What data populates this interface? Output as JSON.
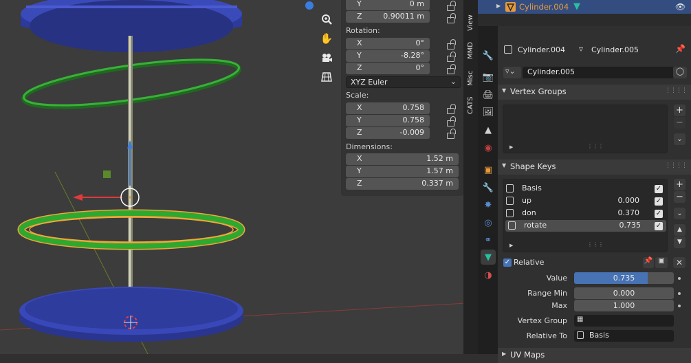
{
  "viewport": {
    "nav_icons": [
      "zoom-icon",
      "hand-icon",
      "camera-icon",
      "grid-icon"
    ]
  },
  "n_panel": {
    "location_partial": [
      {
        "axis": "Y",
        "value": "0 m"
      },
      {
        "axis": "Z",
        "value": "0.90011 m"
      }
    ],
    "rotation_label": "Rotation:",
    "rotation": [
      {
        "axis": "X",
        "value": "0°"
      },
      {
        "axis": "Y",
        "value": "-8.28°"
      },
      {
        "axis": "Z",
        "value": "0°"
      }
    ],
    "rotation_mode": "XYZ Euler",
    "scale_label": "Scale:",
    "scale": [
      {
        "axis": "X",
        "value": "0.758"
      },
      {
        "axis": "Y",
        "value": "0.758"
      },
      {
        "axis": "Z",
        "value": "-0.009"
      }
    ],
    "dimensions_label": "Dimensions:",
    "dimensions": [
      {
        "axis": "X",
        "value": "1.52 m"
      },
      {
        "axis": "Y",
        "value": "1.57 m"
      },
      {
        "axis": "Z",
        "value": "0.337 m"
      }
    ]
  },
  "side_tabs": [
    "View",
    "MMD",
    "Misc",
    "CATS"
  ],
  "outliner": {
    "selected_name": "Cylinder.004",
    "accent": "#e79a3c"
  },
  "properties": {
    "breadcrumb_object": "Cylinder.004",
    "breadcrumb_mesh": "Cylinder.005",
    "mesh_name": "Cylinder.005",
    "vertex_groups_title": "Vertex Groups",
    "shape_keys_title": "Shape Keys",
    "shape_keys": [
      {
        "name": "Basis",
        "value": "",
        "checked": true,
        "active": false
      },
      {
        "name": "up",
        "value": "0.000",
        "checked": true,
        "active": false
      },
      {
        "name": "don",
        "value": "0.370",
        "checked": true,
        "active": false
      },
      {
        "name": "rotate",
        "value": "0.735",
        "checked": true,
        "active": true
      }
    ],
    "relative_label": "Relative",
    "value_label": "Value",
    "value": "0.735",
    "value_fraction": 0.735,
    "range_min_label": "Range Min",
    "range_min": "0.000",
    "max_label": "Max",
    "max": "1.000",
    "vertex_group_label": "Vertex Group",
    "relative_to_label": "Relative To",
    "relative_to": "Basis",
    "next_panel_title": "UV Maps"
  },
  "colors": {
    "selected_row": "#334d80",
    "value_bar": "#4772b3",
    "mesh_icon": "#27c0a0",
    "ring_green": "#2fa82f",
    "ring_outline": "#f2a63a",
    "disc_blue": "#2c3a9e"
  }
}
